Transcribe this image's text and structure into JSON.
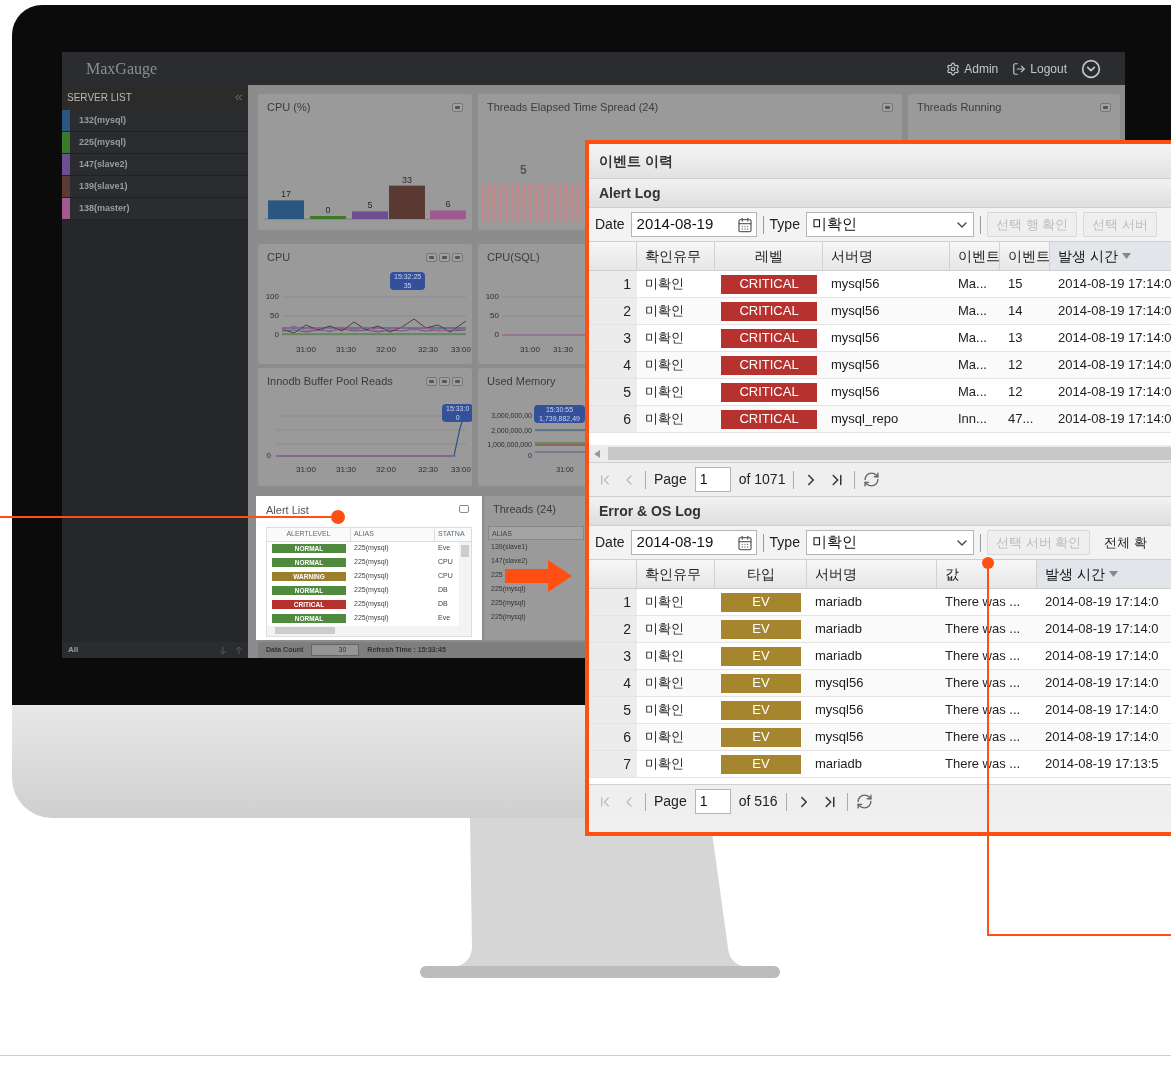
{
  "app": {
    "logo": "MaxGauge",
    "user_menu": [
      {
        "kind": "admin",
        "label": "Admin"
      },
      {
        "kind": "logout",
        "label": "Logout"
      }
    ]
  },
  "sidebar": {
    "title": "SERVER LIST",
    "footer": "All",
    "servers": [
      {
        "name": "132(mysql)",
        "color": "#2b5680"
      },
      {
        "name": "225(mysql)",
        "color": "#3a7a2a"
      },
      {
        "name": "147(slave2)",
        "color": "#6b4f8f"
      },
      {
        "name": "139(slave1)",
        "color": "#5a3a32"
      },
      {
        "name": "138(master)",
        "color": "#a2598f"
      }
    ]
  },
  "panels": {
    "cpu_pct": {
      "title": "CPU (%)",
      "bar_labels": [
        "17",
        "0",
        "5",
        "33",
        "6"
      ]
    },
    "threads_elapsed": {
      "title": "Threads Elapsed Time Spread (24)",
      "label": "5"
    },
    "threads_running": {
      "title": "Threads Running"
    },
    "cpu": {
      "title": "CPU",
      "y_labels": [
        "100",
        "50",
        "0"
      ],
      "x_labels": [
        "31:00",
        "31:30",
        "32:00",
        "32:30",
        "33:00"
      ],
      "tooltip": {
        "time": "15:32:25",
        "value": "35"
      }
    },
    "cpu_sql": {
      "title": "CPU(SQL)",
      "y_labels": [
        "100",
        "50",
        "0"
      ],
      "x_labels": [
        "31:00",
        "31:30"
      ]
    },
    "innodb": {
      "title": "Innodb Buffer Pool Reads",
      "y_labels": [
        "0"
      ],
      "x_labels": [
        "31:00",
        "31:30",
        "32:00",
        "32:30",
        "33:00"
      ],
      "tooltip": {
        "time": "15:33:0",
        "value": "0"
      }
    },
    "used_memory": {
      "title": "Used Memory",
      "y_labels": [
        "3,000,000,00",
        "2,000,000,00",
        "1,000,000,000",
        "0"
      ],
      "x_labels": [
        "31:00"
      ],
      "tooltip": {
        "time": "15:30:55",
        "value": "1,739,882,49"
      }
    },
    "alert_list": {
      "title": "Alert List",
      "columns": [
        "ALERTLEVEL",
        "ALIAS",
        "STATNA"
      ],
      "rows": [
        {
          "level": "NORMAL",
          "kind": "normal",
          "alias": "225(mysql)",
          "stat": "Eve"
        },
        {
          "level": "NORMAL",
          "kind": "normal",
          "alias": "225(mysql)",
          "stat": "CPU"
        },
        {
          "level": "WARNING",
          "kind": "warning",
          "alias": "225(mysql)",
          "stat": "CPU"
        },
        {
          "level": "NORMAL",
          "kind": "normal",
          "alias": "225(mysql)",
          "stat": "DB"
        },
        {
          "level": "CRITICAL",
          "kind": "critical",
          "alias": "225(mysql)",
          "stat": "DB"
        },
        {
          "level": "NORMAL",
          "kind": "normal",
          "alias": "225(mysql)",
          "stat": "Eve"
        }
      ]
    },
    "threads": {
      "title": "Threads (24)",
      "column": "ALIAS",
      "rows": [
        "139(slave1)",
        "147(slave2)",
        "225",
        "225(mysql)",
        "225(mysql)",
        "225(mysql)"
      ]
    }
  },
  "status_bar": {
    "data_count_label": "Data Count",
    "data_count": "30",
    "refresh": "Refresh Time : 15:33:45"
  },
  "event_window": {
    "title": "이벤트 이력",
    "sections": [
      {
        "title": "Alert Log",
        "date_label": "Date",
        "date": "2014-08-19",
        "type_label": "Type",
        "type": "미확인",
        "buttons": [
          {
            "label": "선택 행 확인",
            "disabled": true
          },
          {
            "label": "선택 서버",
            "disabled": true
          }
        ],
        "columns": [
          {
            "kind": "number",
            "sorted": false
          },
          {
            "label": "확인유무",
            "kind": "text",
            "sorted": false
          },
          {
            "label": "레벨",
            "kind": "badge",
            "sorted": false
          },
          {
            "label": "서버명",
            "kind": "text",
            "sorted": false
          },
          {
            "label": "이벤트",
            "kind": "text",
            "sorted": false
          },
          {
            "label": "이벤트",
            "kind": "text",
            "sorted": false
          },
          {
            "label": "발생 시간",
            "kind": "text",
            "sorted": true
          }
        ],
        "rows": [
          {
            "kind": "critical",
            "cells": [
              "1",
              "미확인",
              "CRITICAL",
              "mysql56",
              "Ma...",
              "15",
              "2014-08-19 17:14:0"
            ]
          },
          {
            "kind": "critical",
            "cells": [
              "2",
              "미확인",
              "CRITICAL",
              "mysql56",
              "Ma...",
              "14",
              "2014-08-19 17:14:0"
            ]
          },
          {
            "kind": "critical",
            "cells": [
              "3",
              "미확인",
              "CRITICAL",
              "mysql56",
              "Ma...",
              "13",
              "2014-08-19 17:14:0"
            ]
          },
          {
            "kind": "critical",
            "cells": [
              "4",
              "미확인",
              "CRITICAL",
              "mysql56",
              "Ma...",
              "12",
              "2014-08-19 17:14:0"
            ]
          },
          {
            "kind": "critical",
            "cells": [
              "5",
              "미확인",
              "CRITICAL",
              "mysql56",
              "Ma...",
              "12",
              "2014-08-19 17:14:0"
            ]
          },
          {
            "kind": "critical",
            "cells": [
              "6",
              "미확인",
              "CRITICAL",
              "mysql_repo",
              "Inn...",
              "47...",
              "2014-08-19 17:14:0"
            ]
          }
        ],
        "pager": {
          "page_label": "Page",
          "page": "1",
          "of": "of 1071"
        }
      },
      {
        "title": "Error & OS Log",
        "date_label": "Date",
        "date": "2014-08-19",
        "type_label": "Type",
        "type": "미확인",
        "buttons": [
          {
            "label": "선택 서버 확인",
            "disabled": true
          },
          {
            "label": "전체 확",
            "disabled": false
          }
        ],
        "columns": [
          {
            "kind": "number",
            "sorted": false
          },
          {
            "label": "확인유무",
            "kind": "text",
            "sorted": false
          },
          {
            "label": "타입",
            "kind": "badge",
            "sorted": false
          },
          {
            "label": "서버명",
            "kind": "text",
            "sorted": false
          },
          {
            "label": "값",
            "kind": "text",
            "sorted": false
          },
          {
            "label": "발생 시간",
            "kind": "text",
            "sorted": true
          }
        ],
        "rows": [
          {
            "kind": "ev",
            "cells": [
              "1",
              "미확인",
              "EV",
              "mariadb",
              "There was ...",
              "2014-08-19 17:14:0"
            ]
          },
          {
            "kind": "ev",
            "cells": [
              "2",
              "미확인",
              "EV",
              "mariadb",
              "There was ...",
              "2014-08-19 17:14:0"
            ]
          },
          {
            "kind": "ev",
            "cells": [
              "3",
              "미확인",
              "EV",
              "mariadb",
              "There was ...",
              "2014-08-19 17:14:0"
            ]
          },
          {
            "kind": "ev",
            "cells": [
              "4",
              "미확인",
              "EV",
              "mysql56",
              "There was ...",
              "2014-08-19 17:14:0"
            ]
          },
          {
            "kind": "ev",
            "cells": [
              "5",
              "미확인",
              "EV",
              "mysql56",
              "There was ...",
              "2014-08-19 17:14:0"
            ]
          },
          {
            "kind": "ev",
            "cells": [
              "6",
              "미확인",
              "EV",
              "mysql56",
              "There was ...",
              "2014-08-19 17:14:0"
            ]
          },
          {
            "kind": "ev",
            "cells": [
              "7",
              "미확인",
              "EV",
              "mariadb",
              "There was ...",
              "2014-08-19 17:13:5"
            ]
          }
        ],
        "pager": {
          "page_label": "Page",
          "page": "1",
          "of": "of 516"
        }
      }
    ]
  }
}
